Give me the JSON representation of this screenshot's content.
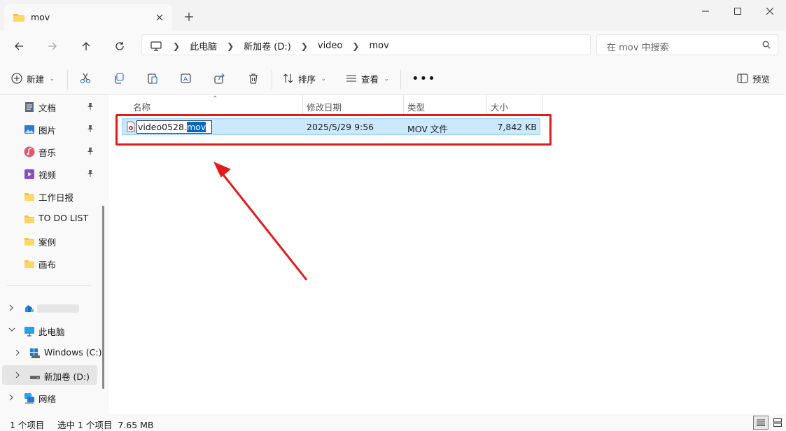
{
  "tab": {
    "title": "mov"
  },
  "address": {
    "crumbs": [
      "此电脑",
      "新加卷 (D:)",
      "video",
      "mov"
    ]
  },
  "search": {
    "placeholder": "在 mov 中搜索"
  },
  "toolbar": {
    "new_label": "新建",
    "sort_label": "排序",
    "view_label": "查看",
    "preview_label": "预览"
  },
  "sidebar": {
    "pinned": [
      {
        "label": "文档",
        "icon": "document-icon"
      },
      {
        "label": "图片",
        "icon": "pictures-icon"
      },
      {
        "label": "音乐",
        "icon": "music-icon"
      },
      {
        "label": "视频",
        "icon": "videos-icon"
      }
    ],
    "folders": [
      "工作日报",
      "TO DO LIST",
      "案例",
      "画布"
    ],
    "this_pc": "此电脑",
    "drive_c": "Windows (C:)",
    "drive_d": "新加卷 (D:)",
    "network": "网络"
  },
  "columns": {
    "name": "名称",
    "date": "修改日期",
    "type": "类型",
    "size": "大小"
  },
  "file": {
    "name_base": "video0528.",
    "name_ext": "mov",
    "date": "2025/5/29 9:56",
    "type": "MOV 文件",
    "size": "7,842 KB"
  },
  "status": {
    "count": "1 个项目",
    "selected": "选中 1 个项目  7.65 MB"
  },
  "colors": {
    "highlight": "#e31b1b",
    "selection": "#cce8ff",
    "accent": "#0066cc"
  }
}
